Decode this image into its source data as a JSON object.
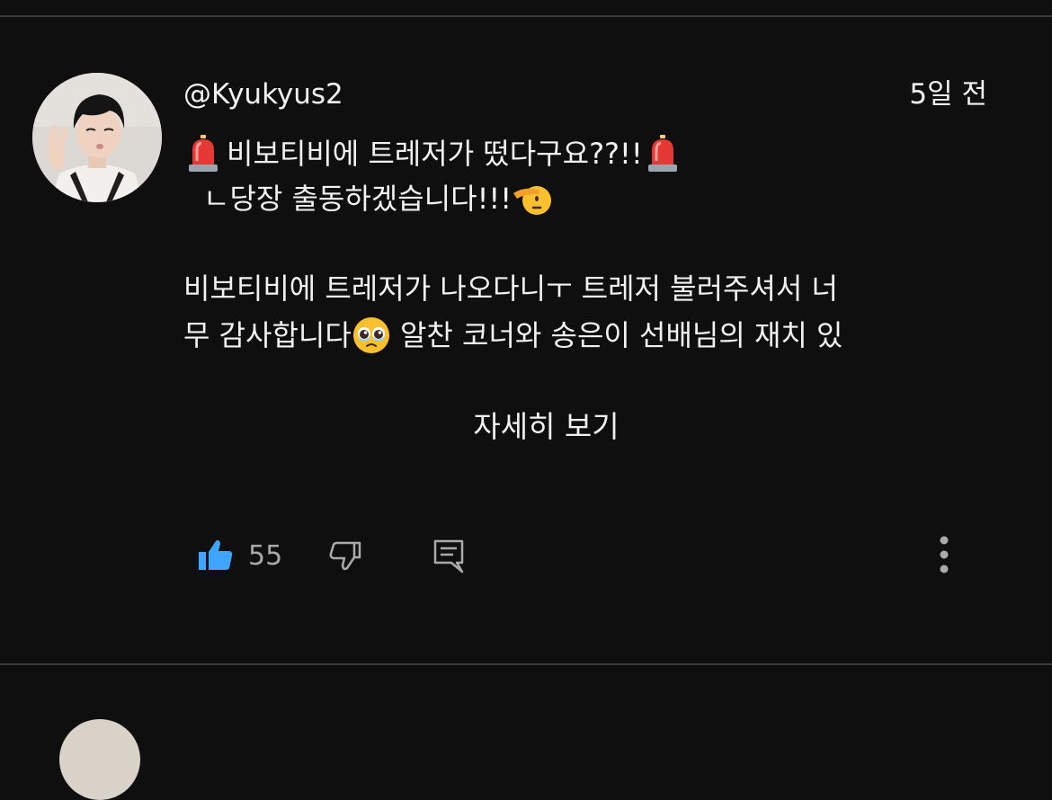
{
  "comment": {
    "handle": "@Kyukyus2",
    "timestamp": "5일 전",
    "lines": {
      "line1_text": "비보티비에 트레저가 떴다구요??!!",
      "line2_text": "ㄴ당장 출동하겠습니다!!!",
      "line3_text": "비보티비에 트레저가 나오다니ㅜ 트레저 불러주셔서 너",
      "line4_before": "무 감사합니다",
      "line4_after": " 알찬 코너와 송은이 선배님의 재치 있"
    },
    "emojis": [
      "police-car-light-icon",
      "saluting-face-icon",
      "pleading-face-icon"
    ],
    "read_more_label": "자세히 보기"
  },
  "actions": {
    "like_count": "55",
    "like_color": "#3ea6ff"
  },
  "colors": {
    "background": "#0f0f0f",
    "text": "#f1f1f1",
    "secondary_text": "#aaaaaa",
    "divider": "#3a3a3a"
  }
}
